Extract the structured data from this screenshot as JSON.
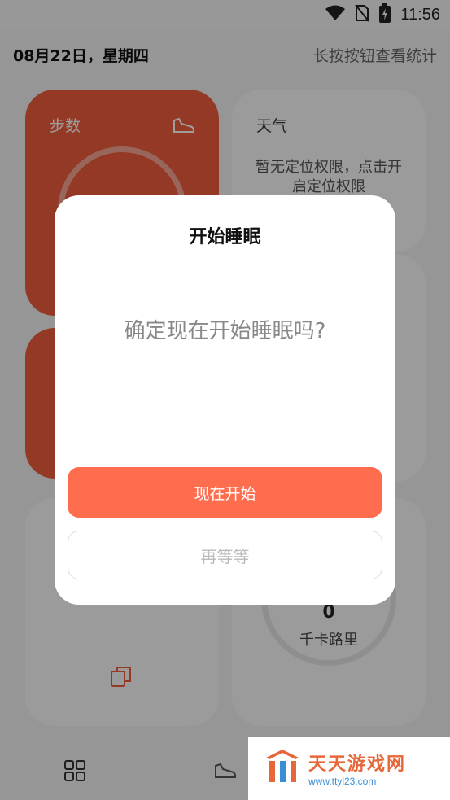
{
  "status_bar": {
    "time": "11:56",
    "icons": [
      "wifi-icon",
      "no-sim-icon",
      "battery-charging-icon"
    ]
  },
  "header": {
    "date": "08月22日，星期四",
    "hint": "长按按钮查看统计"
  },
  "cards": {
    "steps": {
      "title": "步数",
      "icon": "sneaker-icon"
    },
    "weather": {
      "title": "天气",
      "message": "暂无定位权限，点击开启定位权限"
    },
    "calories": {
      "value": "0",
      "unit": "千卡路里"
    },
    "partial_left": {
      "icon": "copy-icon"
    }
  },
  "dialog": {
    "title": "开始睡眠",
    "message": "确定现在开始睡眠吗?",
    "confirm_label": "现在开始",
    "cancel_label": "再等等"
  },
  "bottom_nav": {
    "items": [
      "grid-icon",
      "sneaker-icon"
    ]
  },
  "watermark": {
    "brand": "天天游戏网",
    "url": "www.ttyl23.com"
  },
  "colors": {
    "accent": "#ff6d4f",
    "card_orange": "#ef5c3d"
  }
}
